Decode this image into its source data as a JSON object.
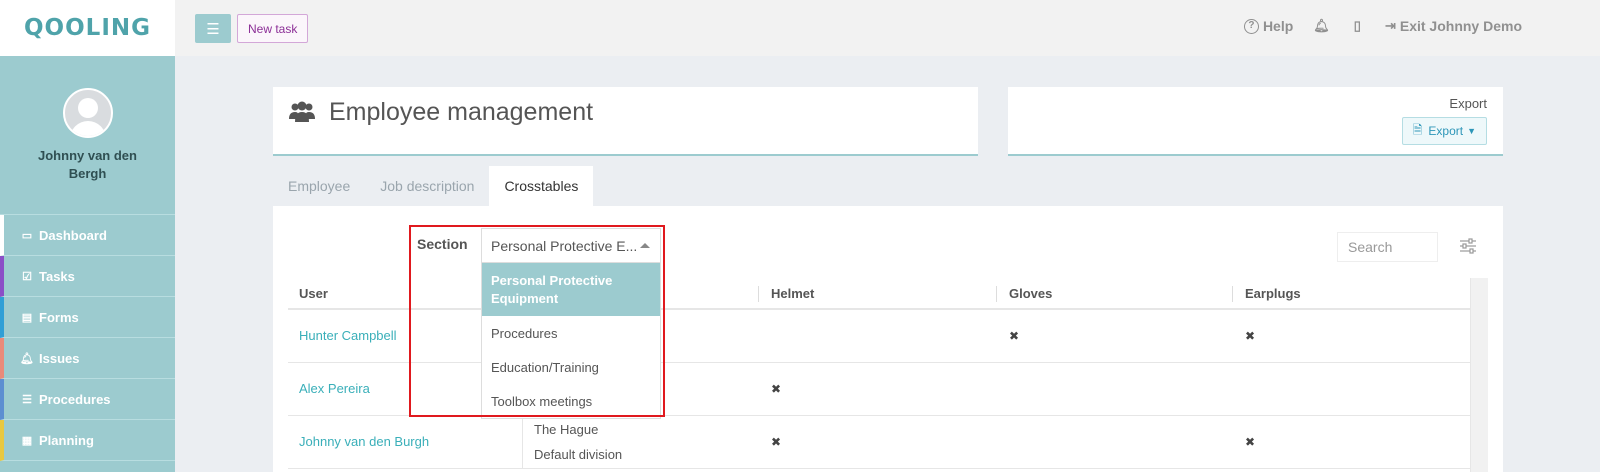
{
  "app": {
    "logo_text": "QOOLING"
  },
  "topbar": {
    "new_task_label": "New task",
    "help_label": "Help",
    "exit_label": "Exit Johnny Demo"
  },
  "sidebar": {
    "user_name": "Johnny van den Bergh",
    "items": [
      {
        "label": "Dashboard",
        "color": "#ffffff"
      },
      {
        "label": "Tasks",
        "color": "#8b4fc7"
      },
      {
        "label": "Forms",
        "color": "#2f9fd6"
      },
      {
        "label": "Issues",
        "color": "#e98a7a"
      },
      {
        "label": "Procedures",
        "color": "#5d8fd1"
      },
      {
        "label": "Planning",
        "color": "#e8c840"
      }
    ]
  },
  "page": {
    "title": "Employee management",
    "export_label": "Export",
    "export_button": "Export"
  },
  "tabs": [
    {
      "label": "Employee",
      "active": false
    },
    {
      "label": "Job description",
      "active": false
    },
    {
      "label": "Crosstables",
      "active": true
    }
  ],
  "filter": {
    "section_label": "Section",
    "selected_value": "Personal Protective E...",
    "options": [
      "Personal Protective Equipment",
      "Procedures",
      "Education/Training",
      "Toolbox meetings"
    ],
    "search_placeholder": "Search"
  },
  "table": {
    "columns": [
      "User",
      "Helmet",
      "Gloves",
      "Earplugs"
    ],
    "rows": [
      {
        "user": "Hunter Campbell",
        "helmet": false,
        "gloves": true,
        "earplugs": true
      },
      {
        "user": "Alex Pereira",
        "helmet": true,
        "gloves": false,
        "earplugs": false
      },
      {
        "user": "Johnny van den Burgh",
        "location": "The Hague",
        "division": "Default division",
        "helmet": true,
        "gloves": false,
        "earplugs": true
      }
    ],
    "mark_symbol": "✖"
  },
  "colors": {
    "accent": "#9ccbcf",
    "link": "#3aafb9",
    "highlight": "#e0191e"
  }
}
